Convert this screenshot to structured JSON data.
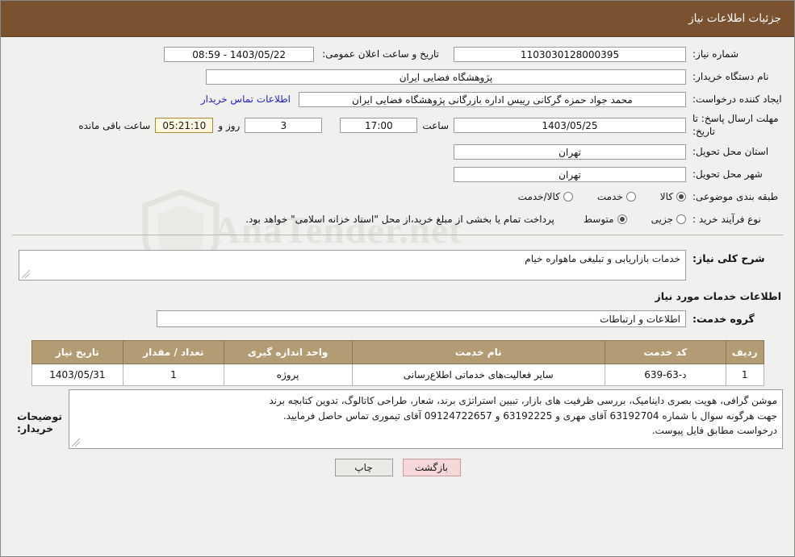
{
  "header": {
    "title": "جزئیات اطلاعات نیاز"
  },
  "watermark": {
    "text": "AnaTender.net",
    "icon": "shield-icon"
  },
  "fields": {
    "tender_number_label": "شماره نیاز:",
    "tender_number_value": "1103030128000395",
    "public_announce_label": "تاریخ و ساعت اعلان عمومی:",
    "public_announce_value": "1403/05/22 - 08:59",
    "buyer_org_label": "نام دستگاه خریدار:",
    "buyer_org_value": "پژوهشگاه فضایی ایران",
    "requester_label": "ایجاد کننده درخواست:",
    "requester_value": "محمد جواد حمزه گرکانی رییس اداره بازرگانی پژوهشگاه فضایی ایران",
    "buyer_contact_link": "اطلاعات تماس خریدار",
    "deadline_label": "مهلت ارسال پاسخ: تا تاریخ:",
    "deadline_date": "1403/05/25",
    "hour_label": "ساعت",
    "deadline_time": "17:00",
    "days_value": "3",
    "days_label": "روز و",
    "countdown_value": "05:21:10",
    "remaining_label": "ساعت باقی مانده",
    "province_label": "استان محل تحویل:",
    "province_value": "تهران",
    "city_label": "شهر محل تحویل:",
    "city_value": "تهران",
    "category_label": "طبقه بندی موضوعی:",
    "purchase_type_label": "نوع فرآیند خرید :",
    "purchase_note": "پرداخت تمام یا بخشی از مبلغ خرید،از محل \"اسناد خزانه اسلامی\" خواهد بود."
  },
  "category_options": [
    {
      "label": "کالا",
      "checked": true
    },
    {
      "label": "خدمت",
      "checked": false
    },
    {
      "label": "کالا/خدمت",
      "checked": false
    }
  ],
  "purchase_options": [
    {
      "label": "جزیی",
      "checked": false
    },
    {
      "label": "متوسط",
      "checked": true
    }
  ],
  "need": {
    "summary_label": "شرح کلی نیاز:",
    "summary_value": "خدمات بازاریابی و تبلیغی ماهواره خیام",
    "services_title": "اطلاعات خدمات مورد نیاز",
    "group_label": "گروه خدمت:",
    "group_value": "اطلاعات و ارتباطات"
  },
  "table": {
    "headers": [
      "ردیف",
      "کد خدمت",
      "نام خدمت",
      "واحد اندازه گیری",
      "تعداد / مقدار",
      "تاریخ نیاز"
    ],
    "rows": [
      {
        "row": "1",
        "code": "د-63-639",
        "name": "سایر فعالیت‌های خدماتی اطلاع‌رسانی",
        "unit": "پروژه",
        "qty": "1",
        "date": "1403/05/31"
      }
    ]
  },
  "buyer_notes": {
    "label": "توضیحات خریدار:",
    "lines": [
      "موشن گرافی، هویت بصری داینامیک، بررسی ظرفیت های بازار، تبیین استراتژی برند، شعار، طراحی کاتالوگ، تدوین کتابچه برند",
      "جهت هرگونه سوال با شماره 63192704 آقای مهری و 63192225 و 09124722657 آقای تیموری تماس حاصل فرمایید.",
      "درخواست مطابق فایل پیوست."
    ]
  },
  "footer": {
    "print_label": "چاپ",
    "back_label": "بازگشت"
  }
}
